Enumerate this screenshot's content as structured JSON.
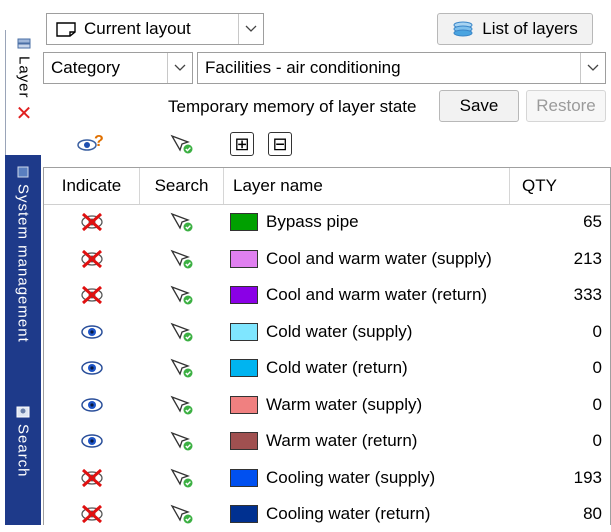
{
  "sidebar": {
    "tabs": [
      {
        "label": "Layer",
        "active": true
      },
      {
        "label": "System management",
        "active": false
      },
      {
        "label": "Search",
        "active": false
      }
    ],
    "accent": "#1e3a8a"
  },
  "toolbar": {
    "layout_value": "Current layout",
    "list_button": "List of layers",
    "category_value": "Category",
    "facility_value": "Facilities - air conditioning",
    "memory_label": "Temporary memory of layer state",
    "save_label": "Save",
    "restore_label": "Restore",
    "expand_glyph": "⊞",
    "collapse_glyph": "⊟"
  },
  "table": {
    "headers": {
      "indicate": "Indicate",
      "search": "Search",
      "name": "Layer name",
      "qty": "QTY"
    },
    "rows": [
      {
        "indicate": "hidden",
        "name": "Bypass pipe",
        "color": "#00a000",
        "qty": "65"
      },
      {
        "indicate": "hidden",
        "name": "Cool and warm water (supply)",
        "color": "#e080f0",
        "qty": "213"
      },
      {
        "indicate": "hidden",
        "name": "Cool and warm water (return)",
        "color": "#8a00e6",
        "qty": "333"
      },
      {
        "indicate": "visible",
        "name": "Cold water (supply)",
        "color": "#7fe6ff",
        "qty": "0"
      },
      {
        "indicate": "visible",
        "name": "Cold water (return)",
        "color": "#00b4f0",
        "qty": "0"
      },
      {
        "indicate": "visible",
        "name": "Warm water (supply)",
        "color": "#f08080",
        "qty": "0"
      },
      {
        "indicate": "visible",
        "name": "Warm water (return)",
        "color": "#a05050",
        "qty": "0"
      },
      {
        "indicate": "hidden",
        "name": "Cooling water (supply)",
        "color": "#0050f0",
        "qty": "193"
      },
      {
        "indicate": "hidden",
        "name": "Cooling water (return)",
        "color": "#003090",
        "qty": "80"
      }
    ]
  }
}
